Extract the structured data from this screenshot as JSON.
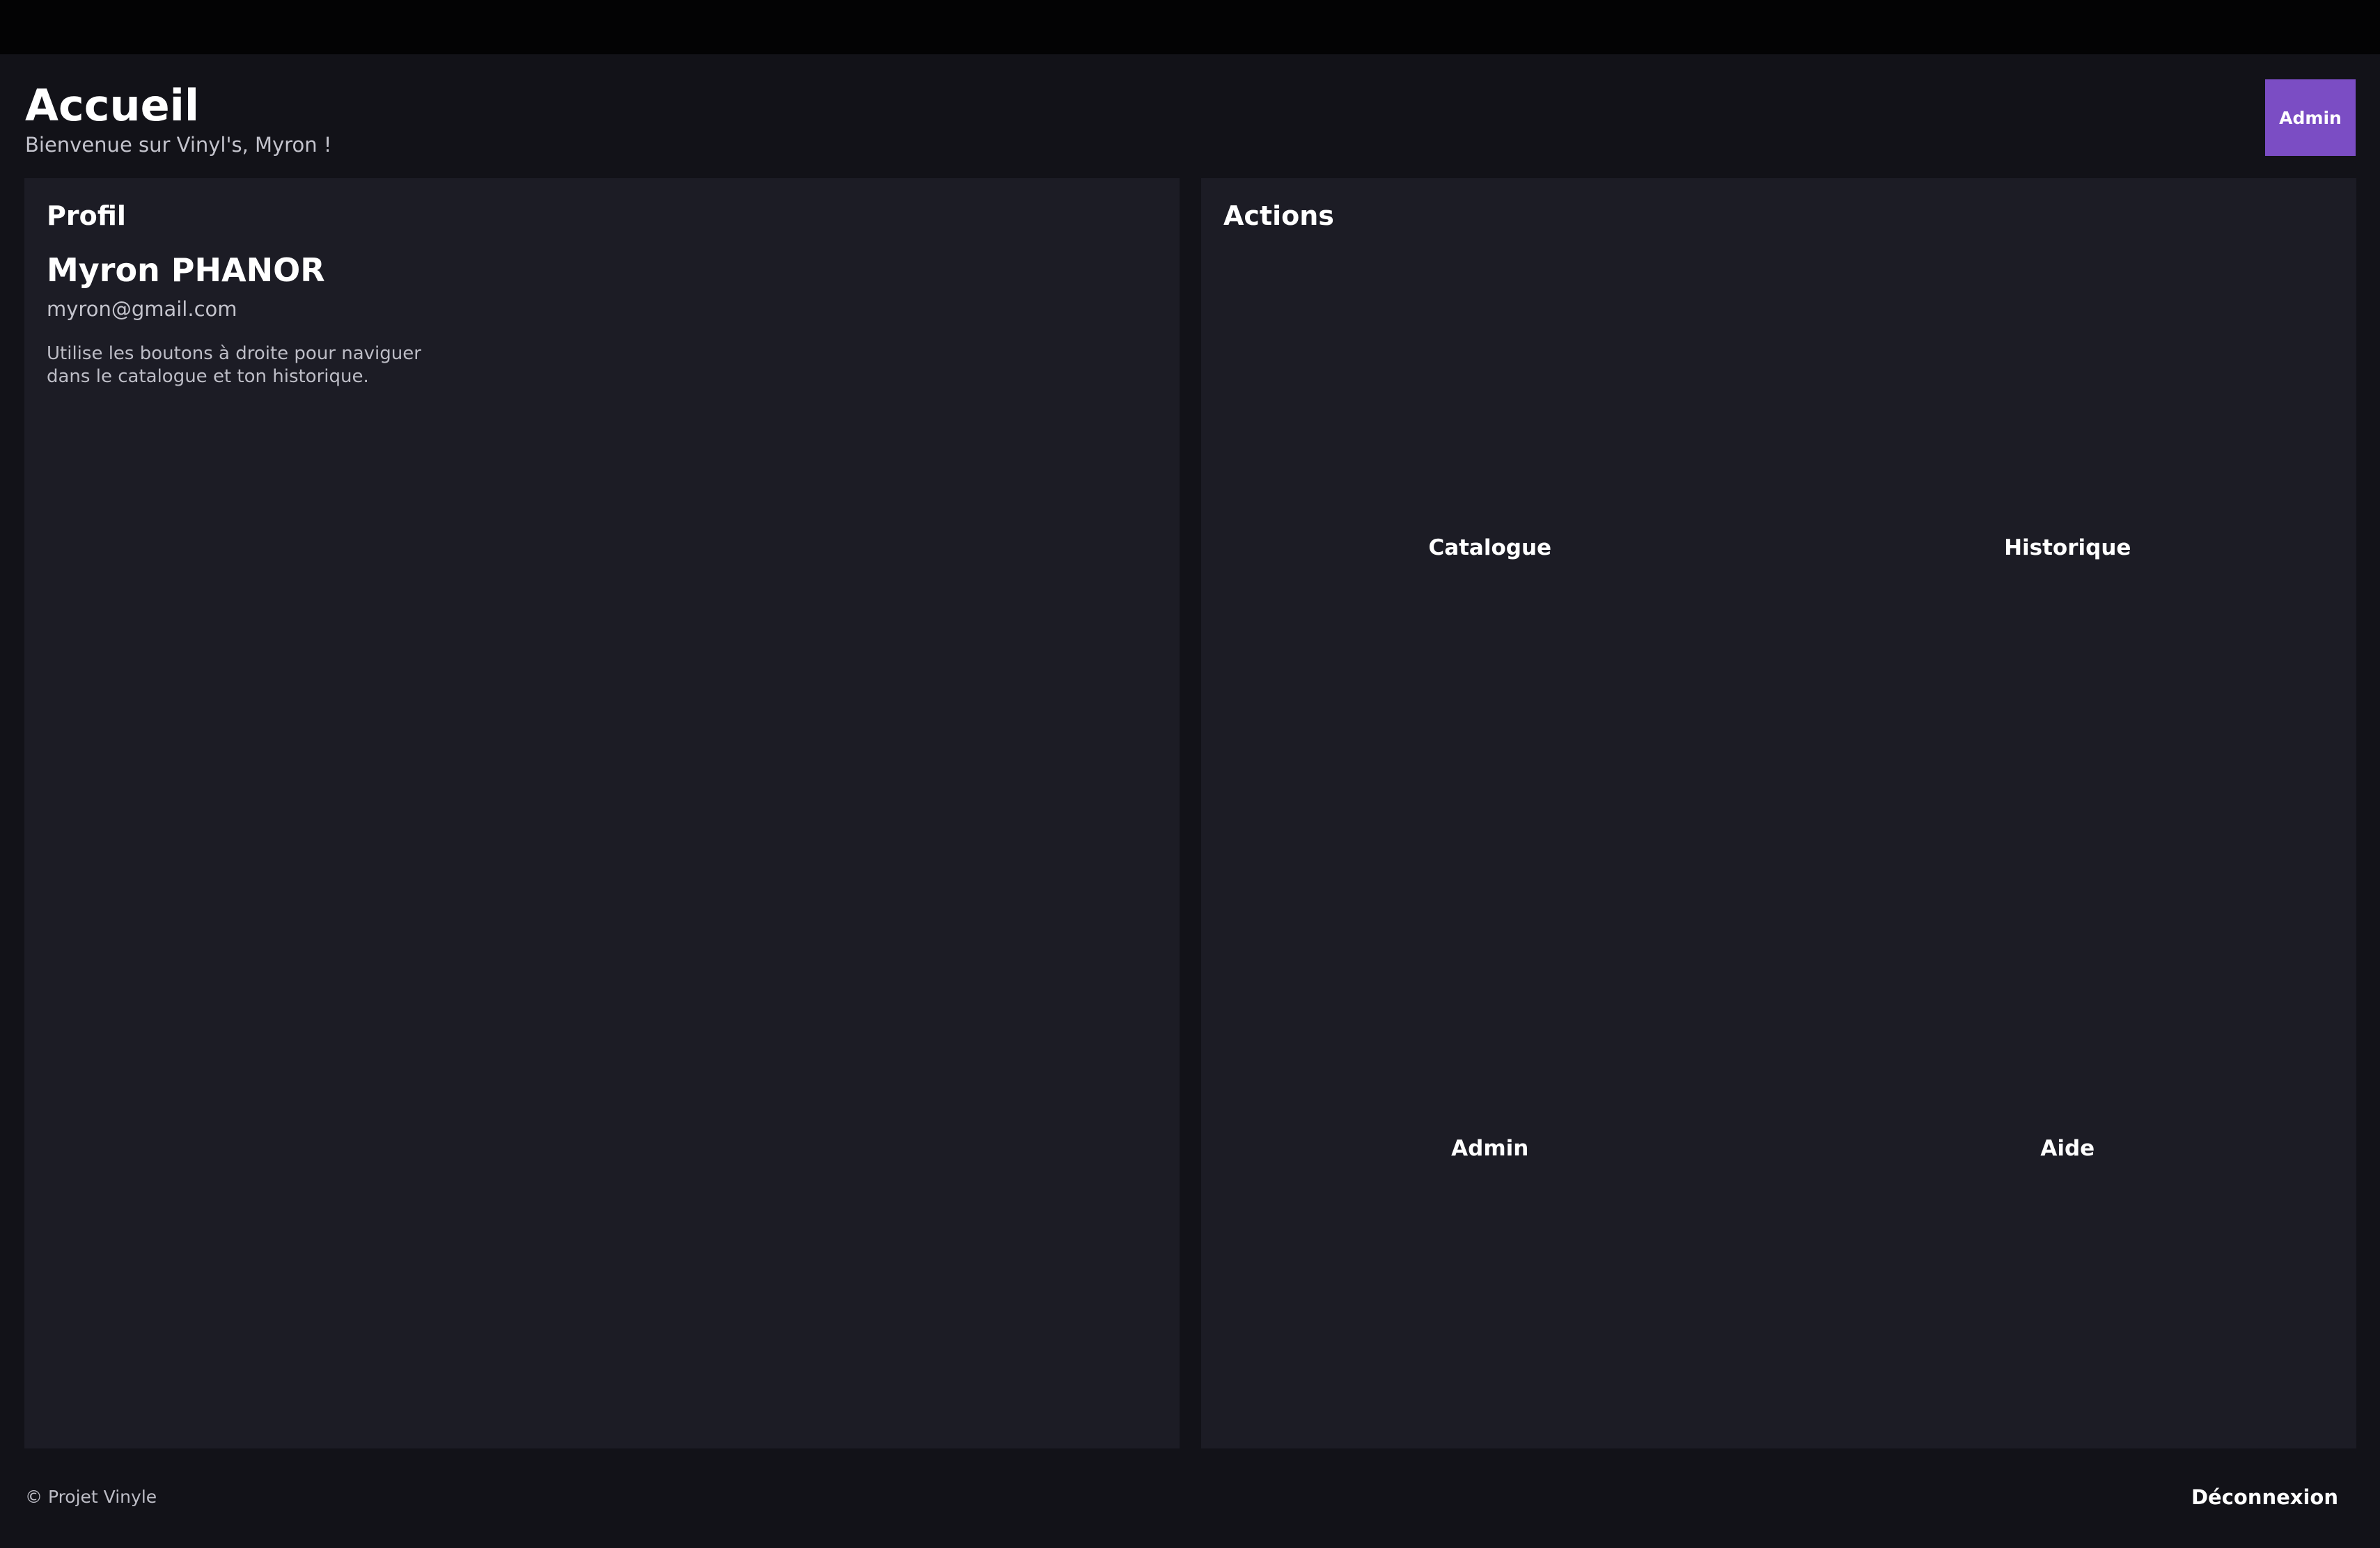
{
  "header": {
    "title": "Accueil",
    "subtitle": "Bienvenue sur Vinyl's, Myron !",
    "admin_button": "Admin"
  },
  "profile": {
    "title": "Profil",
    "name": "Myron PHANOR",
    "email": "myron@gmail.com",
    "hint": "Utilise les boutons à droite pour naviguer dans le catalogue et ton historique."
  },
  "actions": {
    "title": "Actions",
    "items": [
      {
        "label": "Catalogue"
      },
      {
        "label": "Historique"
      },
      {
        "label": "Admin"
      },
      {
        "label": "Aide"
      }
    ]
  },
  "footer": {
    "copyright": "© Projet Vinyle",
    "logout": "Déconnexion"
  },
  "colors": {
    "accent": "#7b4dc4",
    "background": "#121218",
    "panel": "#1c1c25",
    "topbar": "#030304"
  }
}
